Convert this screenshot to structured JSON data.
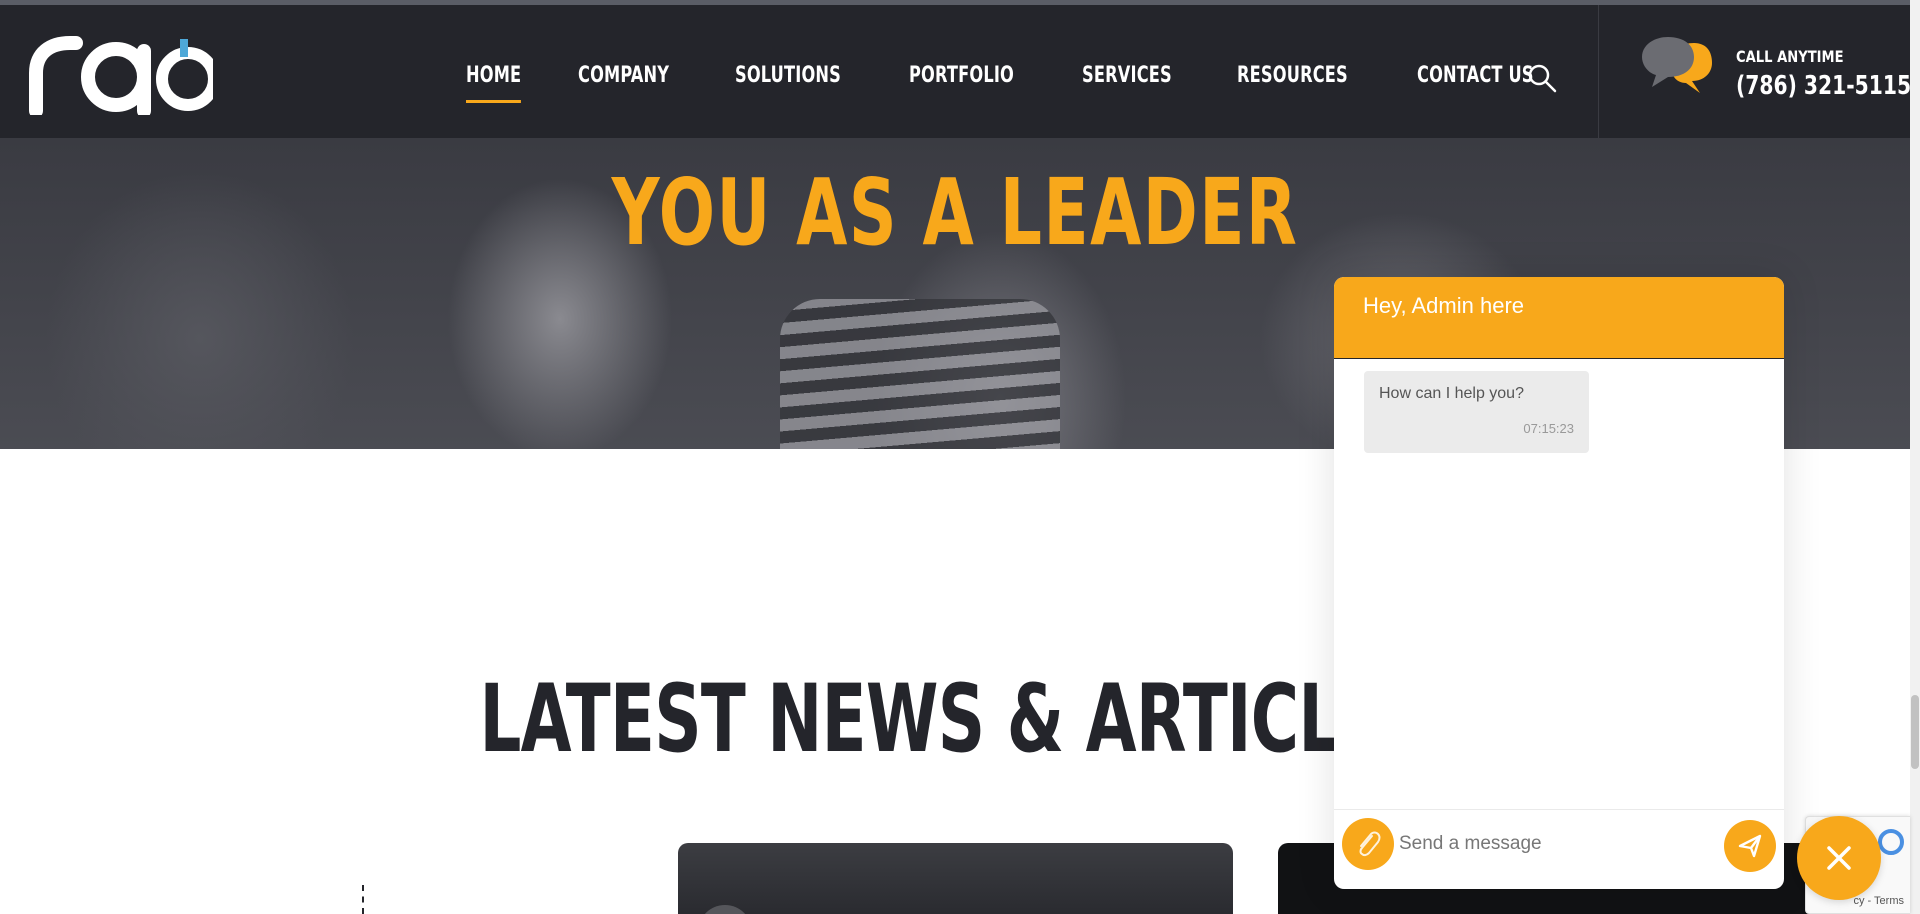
{
  "nav": {
    "items": [
      {
        "label": "HOME",
        "active": true
      },
      {
        "label": "COMPANY",
        "active": false
      },
      {
        "label": "SOLUTIONS",
        "active": false
      },
      {
        "label": "PORTFOLIO",
        "active": false
      },
      {
        "label": "SERVICES",
        "active": false
      },
      {
        "label": "RESOURCES",
        "active": false
      },
      {
        "label": "CONTACT US",
        "active": false
      }
    ]
  },
  "contact": {
    "label": "CALL ANYTIME",
    "phone": "(786) 321-5115"
  },
  "hero": {
    "title": "YOU AS A LEADER"
  },
  "news": {
    "title": "LATEST NEWS & ARTICLES"
  },
  "chat": {
    "header": "Hey, Admin here",
    "messages": [
      {
        "text": "How can I help you?",
        "time": "07:15:23"
      }
    ],
    "input_placeholder": "Send a message"
  },
  "recaptcha": {
    "text": "cy - Terms"
  },
  "colors": {
    "accent": "#f8a81b",
    "nav_bg": "#24252b",
    "heading": "#24252b"
  },
  "icons": {
    "search": "search-icon",
    "call": "chat-bubbles-icon",
    "attach": "paperclip-icon",
    "send": "paper-plane-icon",
    "close": "close-icon"
  }
}
